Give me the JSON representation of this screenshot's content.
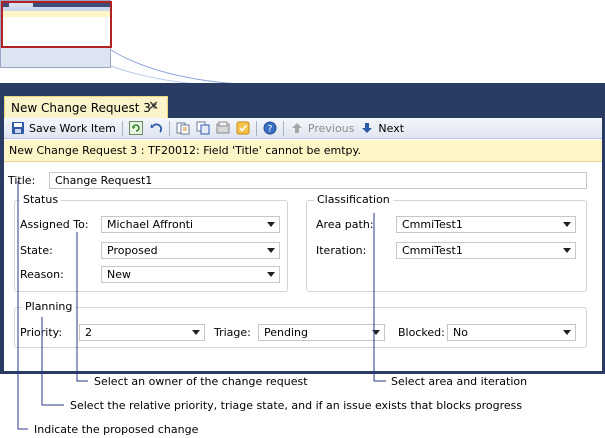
{
  "tab": {
    "title": "New Change Request 3*",
    "close": "✕"
  },
  "toolbar": {
    "save_label": "Save Work Item",
    "previous_label": "Previous",
    "next_label": "Next"
  },
  "infobar": {
    "message": "New Change Request 3 : TF20012: Field 'Title' cannot be emtpy."
  },
  "form": {
    "title_label": "Title:",
    "title_value": "Change Request1",
    "status": {
      "group_label": "Status",
      "assigned_label": "Assigned To:",
      "assigned_value": "Michael Affronti",
      "state_label": "State:",
      "state_value": "Proposed",
      "reason_label": "Reason:",
      "reason_value": "New"
    },
    "classification": {
      "group_label": "Classification",
      "area_label": "Area path:",
      "area_value": "CmmiTest1",
      "iteration_label": "Iteration:",
      "iteration_value": "CmmiTest1"
    },
    "planning": {
      "group_label": "Planning",
      "priority_label": "Priority:",
      "priority_value": "2",
      "triage_label": "Triage:",
      "triage_value": "Pending",
      "blocked_label": "Blocked:",
      "blocked_value": "No"
    }
  },
  "annotations": {
    "owner": "Select an owner of the change request",
    "area": "Select area and iteration",
    "priority": "Select the relative priority, triage state, and if an issue exists that blocks progress",
    "proposed": "Indicate the proposed change"
  },
  "colors": {
    "frame": "#2a3b64",
    "infobar": "#fff6c8",
    "tab": "#fbf3c9",
    "callout_line": "#2b3a8c",
    "highlight": "#b22222"
  }
}
